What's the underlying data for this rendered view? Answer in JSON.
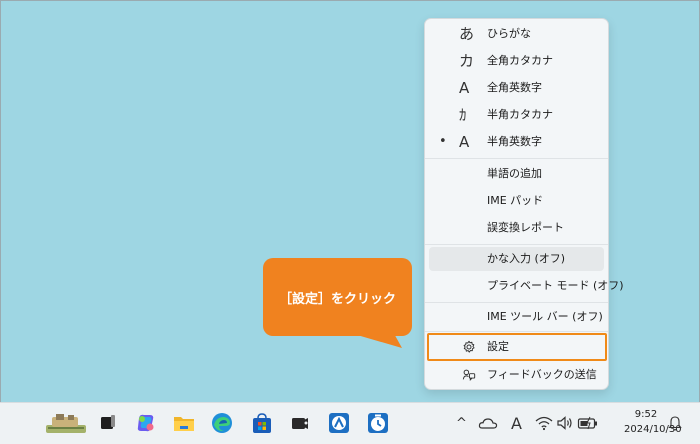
{
  "menu": {
    "items": [
      {
        "glyph": "あ",
        "label": "ひらがな",
        "checked": false
      },
      {
        "glyph": "カ",
        "label": "全角カタカナ",
        "checked": false
      },
      {
        "glyph": "A",
        "label": "全角英数字",
        "checked": false
      },
      {
        "glyph": "ｶ",
        "label": "半角カタカナ",
        "checked": false
      },
      {
        "glyph": "A",
        "label": "半角英数字",
        "checked": true,
        "bullet": "•"
      },
      {
        "label": "単語の追加"
      },
      {
        "label": "IME パッド"
      },
      {
        "label": "誤変換レポート"
      },
      {
        "label": "かな入力 (オフ)"
      },
      {
        "label": "プライベート モード (オフ)"
      },
      {
        "label": "IME ツール バー (オフ)"
      },
      {
        "label": "設定",
        "icon": "gear-icon"
      },
      {
        "label": "フィードバックの送信",
        "icon": "feedback-icon"
      }
    ]
  },
  "callout": {
    "text": "［設定］をクリック"
  },
  "taskbar": {
    "icons": [
      "widgets-icon",
      "task-view-icon",
      "copilot-icon",
      "file-explorer-icon",
      "edge-icon",
      "store-icon",
      "app-icon",
      "network-app-icon",
      "clock-app-icon"
    ],
    "tray": {
      "chevron": "^",
      "ime_mode": "A"
    },
    "clock": {
      "time": "9:52",
      "date": "2024/10/30"
    }
  },
  "colors": {
    "desktop": "#9ed6e3",
    "accent_orange": "#f0821f",
    "highlight_border": "#f08a18"
  }
}
